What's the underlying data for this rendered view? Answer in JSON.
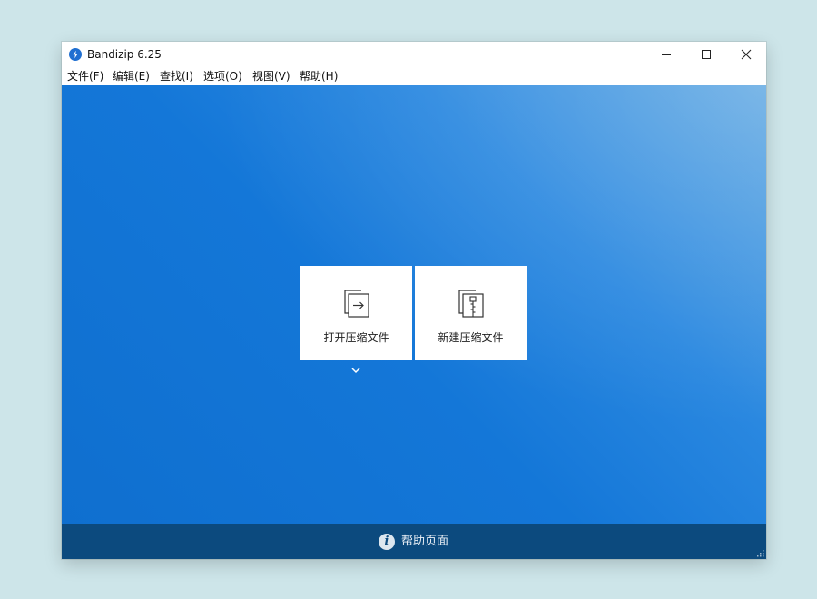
{
  "window": {
    "title": "Bandizip 6.25",
    "controls": {
      "minimize_icon": "minimize-icon",
      "maximize_icon": "maximize-icon",
      "close_icon": "close-icon"
    }
  },
  "menubar": {
    "items": [
      {
        "label": "文件(F)"
      },
      {
        "label": "编辑(E)"
      },
      {
        "label": "查找(I)"
      },
      {
        "label": "选项(O)"
      },
      {
        "label": "视图(V)"
      },
      {
        "label": "帮助(H)"
      }
    ]
  },
  "main": {
    "tiles": [
      {
        "label": "打开压缩文件",
        "icon": "open-archive-icon"
      },
      {
        "label": "新建压缩文件",
        "icon": "new-archive-icon"
      }
    ],
    "dropdown_icon": "chevron-down-icon"
  },
  "footer": {
    "help_label": "帮助页面",
    "help_icon": "info-icon"
  },
  "colors": {
    "background": "#cde5e9",
    "content_blue": "#1477d8",
    "footer_blue": "#0c4a7e",
    "tile_bg": "#ffffff"
  }
}
